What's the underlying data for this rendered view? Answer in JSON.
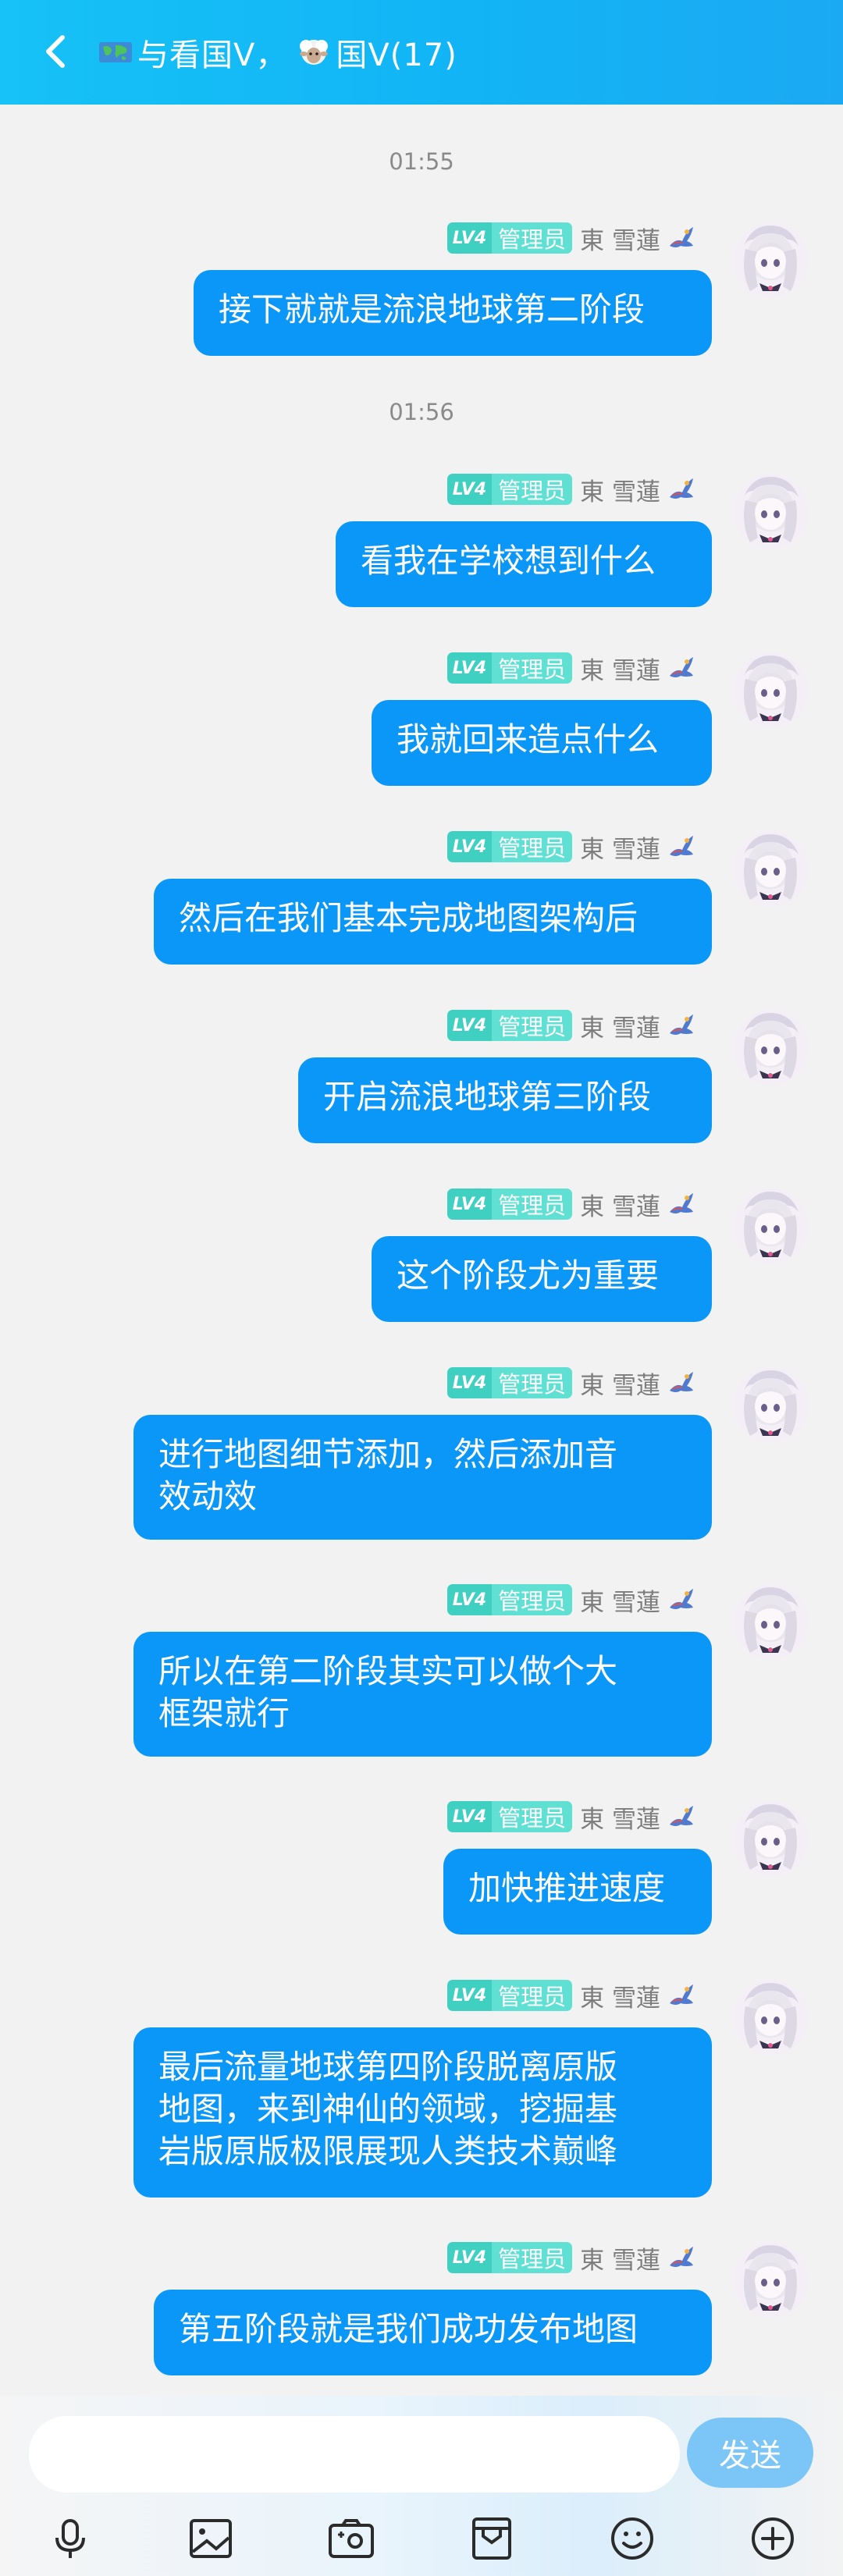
{
  "header": {
    "title_part1": "与看国V，",
    "title_part2": "国V(17)"
  },
  "messages": [
    {
      "time": "01:55",
      "level": "LV4",
      "role": "管理员",
      "name": "東 雪蓮",
      "text": "接下就就是流浪地球第二阶段"
    },
    {
      "time": "01:56",
      "level": "LV4",
      "role": "管理员",
      "name": "東 雪蓮",
      "text": "看我在学校想到什么"
    },
    {
      "level": "LV4",
      "role": "管理员",
      "name": "東 雪蓮",
      "text": "我就回来造点什么"
    },
    {
      "level": "LV4",
      "role": "管理员",
      "name": "東 雪蓮",
      "text": "然后在我们基本完成地图架构后"
    },
    {
      "level": "LV4",
      "role": "管理员",
      "name": "東 雪蓮",
      "text": "开启流浪地球第三阶段"
    },
    {
      "level": "LV4",
      "role": "管理员",
      "name": "東 雪蓮",
      "text": "这个阶段尤为重要"
    },
    {
      "level": "LV4",
      "role": "管理员",
      "name": "東 雪蓮",
      "text": "进行地图细节添加，然后添加音\n效动效"
    },
    {
      "level": "LV4",
      "role": "管理员",
      "name": "東 雪蓮",
      "text": "所以在第二阶段其实可以做个大\n框架就行"
    },
    {
      "level": "LV4",
      "role": "管理员",
      "name": "東 雪蓮",
      "text": "加快推进速度"
    },
    {
      "level": "LV4",
      "role": "管理员",
      "name": "東 雪蓮",
      "text": "最后流量地球第四阶段脱离原版\n地图，来到神仙的领域，挖掘基\n岩版原版极限展现人类技术巅峰"
    },
    {
      "level": "LV4",
      "role": "管理员",
      "name": "東 雪蓮",
      "text": "第五阶段就是我们成功发布地图"
    }
  ],
  "composer": {
    "input_value": "",
    "send_label": "发送"
  },
  "toolbar": [
    "microphone-icon",
    "image-icon",
    "camera-icon",
    "folder-icon",
    "emoji-icon",
    "plus-icon"
  ],
  "colors": {
    "header": "#16c2f7",
    "bubble": "#0b97f8",
    "badge": "#3fd0c2",
    "send": "#7cc5f7"
  }
}
